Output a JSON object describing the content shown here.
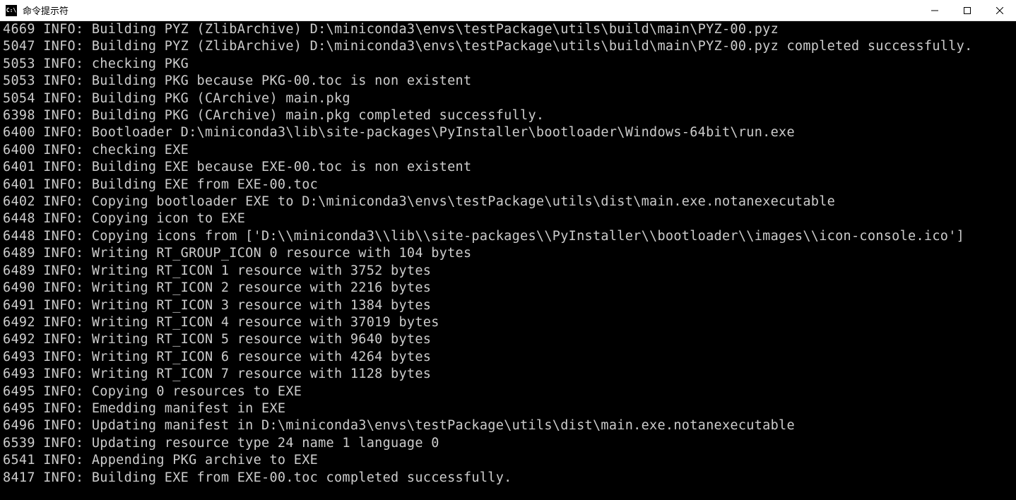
{
  "window": {
    "title": "命令提示符",
    "icon_text": "C:\\"
  },
  "terminal": {
    "lines": [
      "4669 INFO: Building PYZ (ZlibArchive) D:\\miniconda3\\envs\\testPackage\\utils\\build\\main\\PYZ-00.pyz",
      "5047 INFO: Building PYZ (ZlibArchive) D:\\miniconda3\\envs\\testPackage\\utils\\build\\main\\PYZ-00.pyz completed successfully.",
      "",
      "5053 INFO: checking PKG",
      "5053 INFO: Building PKG because PKG-00.toc is non existent",
      "5054 INFO: Building PKG (CArchive) main.pkg",
      "6398 INFO: Building PKG (CArchive) main.pkg completed successfully.",
      "6400 INFO: Bootloader D:\\miniconda3\\lib\\site-packages\\PyInstaller\\bootloader\\Windows-64bit\\run.exe",
      "6400 INFO: checking EXE",
      "6401 INFO: Building EXE because EXE-00.toc is non existent",
      "6401 INFO: Building EXE from EXE-00.toc",
      "6402 INFO: Copying bootloader EXE to D:\\miniconda3\\envs\\testPackage\\utils\\dist\\main.exe.notanexecutable",
      "6448 INFO: Copying icon to EXE",
      "6448 INFO: Copying icons from ['D:\\\\miniconda3\\\\lib\\\\site-packages\\\\PyInstaller\\\\bootloader\\\\images\\\\icon-console.ico']",
      "6489 INFO: Writing RT_GROUP_ICON 0 resource with 104 bytes",
      "6489 INFO: Writing RT_ICON 1 resource with 3752 bytes",
      "6490 INFO: Writing RT_ICON 2 resource with 2216 bytes",
      "6491 INFO: Writing RT_ICON 3 resource with 1384 bytes",
      "6492 INFO: Writing RT_ICON 4 resource with 37019 bytes",
      "6492 INFO: Writing RT_ICON 5 resource with 9640 bytes",
      "6493 INFO: Writing RT_ICON 6 resource with 4264 bytes",
      "6493 INFO: Writing RT_ICON 7 resource with 1128 bytes",
      "6495 INFO: Copying 0 resources to EXE",
      "6495 INFO: Emedding manifest in EXE",
      "6496 INFO: Updating manifest in D:\\miniconda3\\envs\\testPackage\\utils\\dist\\main.exe.notanexecutable",
      "6539 INFO: Updating resource type 24 name 1 language 0",
      "6541 INFO: Appending PKG archive to EXE",
      "8417 INFO: Building EXE from EXE-00.toc completed successfully."
    ]
  }
}
